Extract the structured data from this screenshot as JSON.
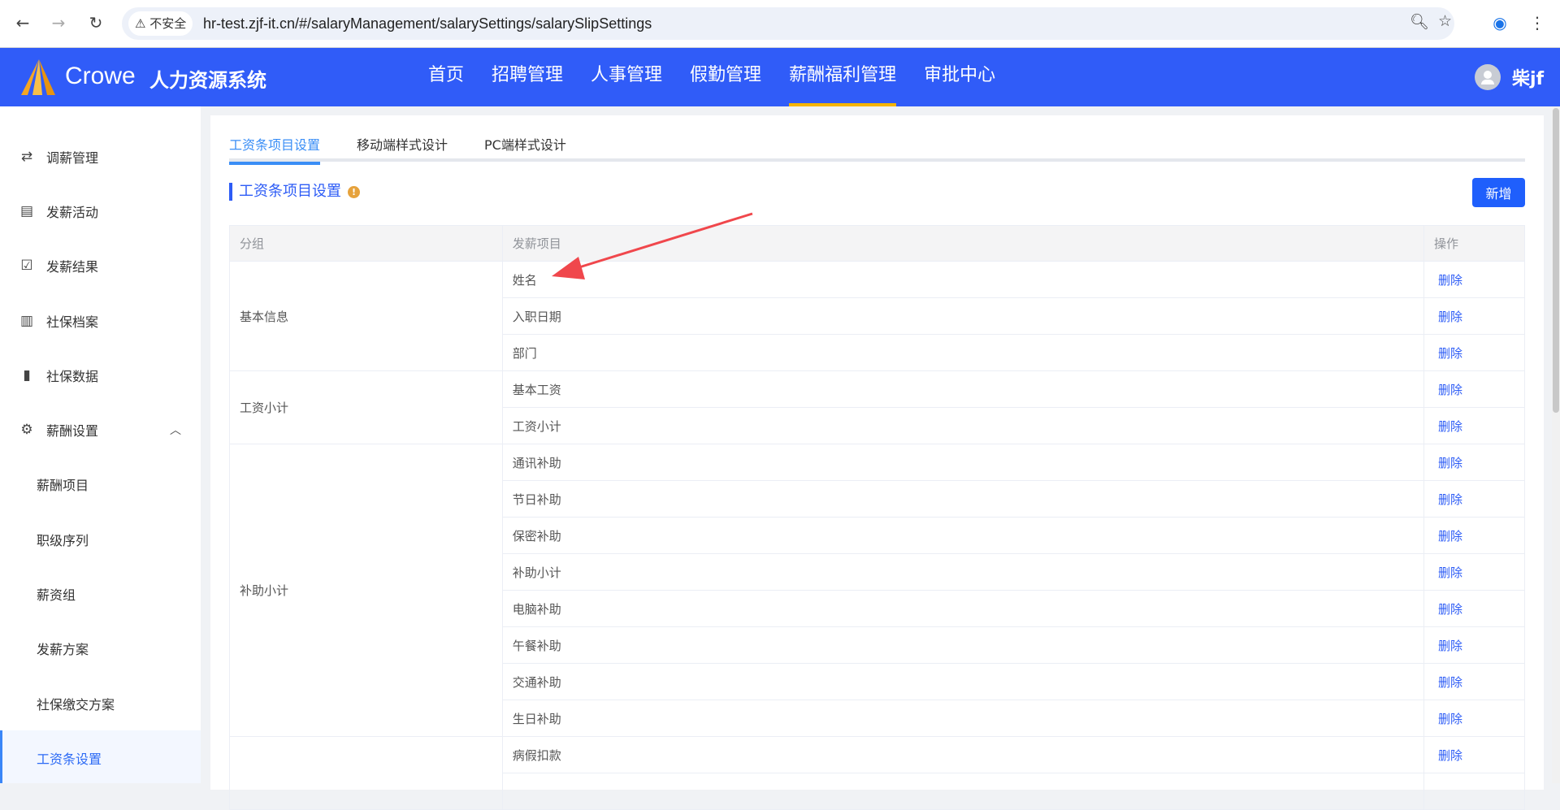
{
  "browser": {
    "security": "不安全",
    "url": "hr-test.zjf-it.cn/#/salaryManagement/salarySettings/salarySlipSettings"
  },
  "header": {
    "brand": "Crowe",
    "system": "人力资源系统",
    "menu": [
      "首页",
      "招聘管理",
      "人事管理",
      "假勤管理",
      "薪酬福利管理",
      "审批中心"
    ],
    "active_menu": "薪酬福利管理",
    "user": "柴jf"
  },
  "sidebar": {
    "items": [
      {
        "label": "调薪管理",
        "icon": "exchange-icon"
      },
      {
        "label": "发薪活动",
        "icon": "clipboard-icon"
      },
      {
        "label": "发薪结果",
        "icon": "clipboard-check-icon"
      },
      {
        "label": "社保档案",
        "icon": "archive-icon"
      },
      {
        "label": "社保数据",
        "icon": "bar-chart-icon"
      },
      {
        "label": "薪酬设置",
        "icon": "gear-icon"
      }
    ],
    "sub_items": [
      "薪酬项目",
      "职级序列",
      "薪资组",
      "发薪方案",
      "社保缴交方案",
      "工资条设置"
    ],
    "active": "工资条设置"
  },
  "tabs": [
    "工资条项目设置",
    "移动端样式设计",
    "PC端样式设计"
  ],
  "section_title": "工资条项目设置",
  "add_button": "新增",
  "table": {
    "headers": [
      "分组",
      "发薪项目",
      "操作"
    ],
    "action": "删除",
    "groups": [
      {
        "name": "基本信息",
        "items": [
          "姓名",
          "入职日期",
          "部门"
        ]
      },
      {
        "name": "工资小计",
        "items": [
          "基本工资",
          "工资小计"
        ]
      },
      {
        "name": "补助小计",
        "items": [
          "通讯补助",
          "节日补助",
          "保密补助",
          "补助小计",
          "电脑补助",
          "午餐补助",
          "交通补助",
          "生日补助"
        ]
      },
      {
        "name": "",
        "items": [
          "病假扣款",
          ""
        ]
      }
    ]
  },
  "colors": {
    "header": "#305cf8",
    "accent": "#2d5cf6",
    "tab_active": "#3a8ef6",
    "annotation_arrow": "#f0474c"
  }
}
